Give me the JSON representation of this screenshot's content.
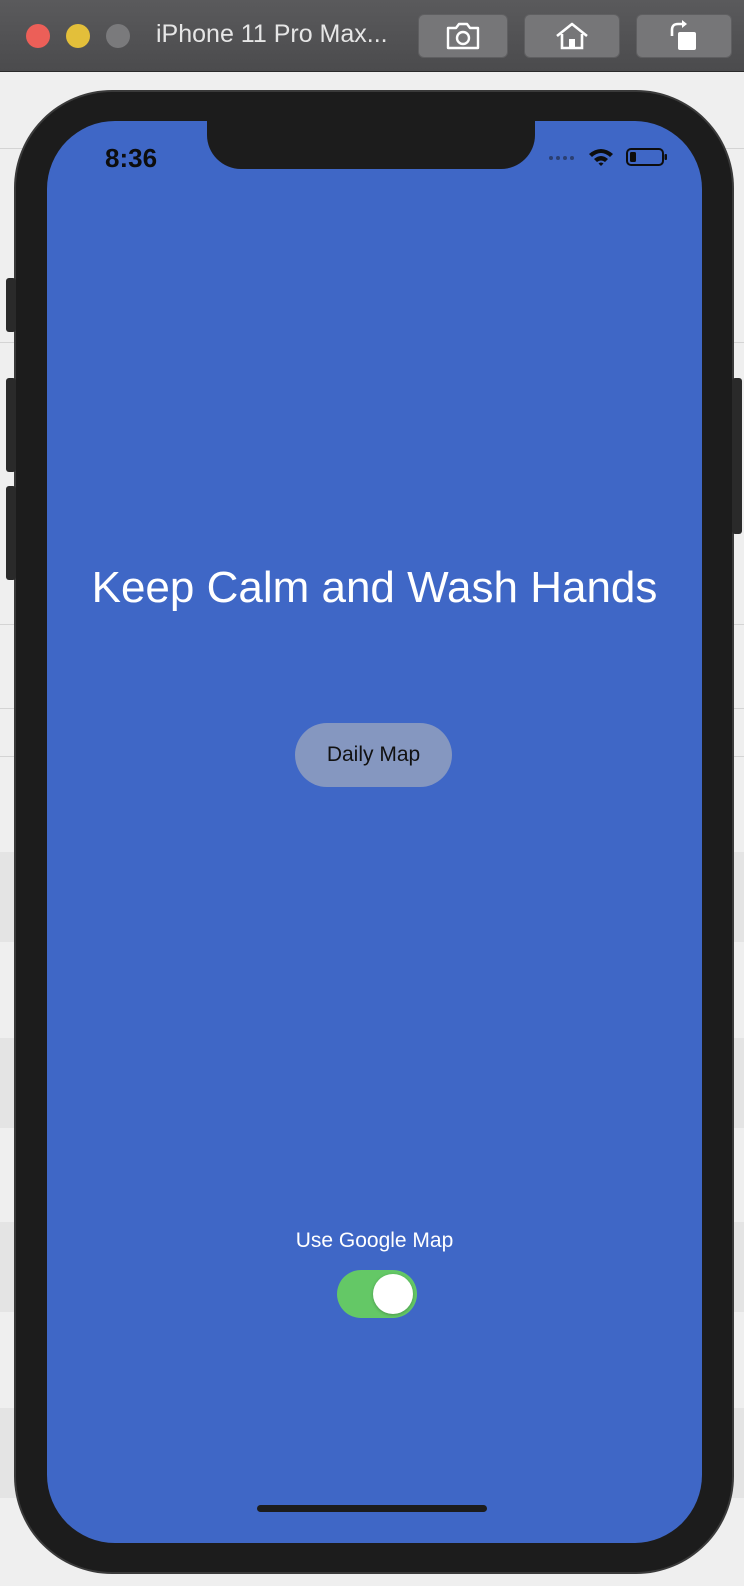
{
  "window": {
    "title": "iPhone 11 Pro Max...",
    "toolbar": {
      "screenshot": "camera-icon",
      "home": "home-icon",
      "rotate": "rotate-icon"
    }
  },
  "status_bar": {
    "time": "8:36",
    "icons": [
      "cellular-signal-icon",
      "wifi-icon",
      "battery-icon"
    ]
  },
  "app": {
    "background_color": "#3f67c6",
    "headline": "Keep Calm and Wash Hands",
    "daily_map_button": "Daily Map",
    "toggle_label": "Use Google Map",
    "toggle_on": true,
    "toggle_color": "#64c866"
  }
}
